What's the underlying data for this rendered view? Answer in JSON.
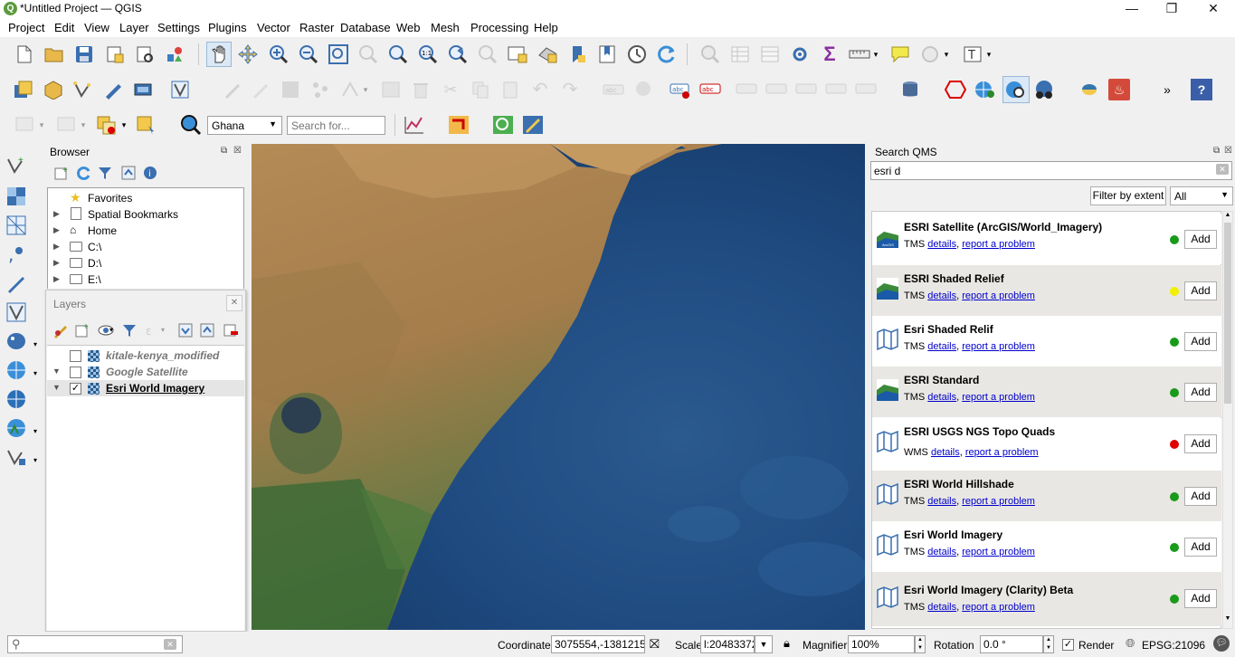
{
  "window": {
    "title": "*Untitled Project — QGIS",
    "minimize": "—",
    "maximize": "❐",
    "close": "✕"
  },
  "menu": [
    "Project",
    "Edit",
    "View",
    "Layer",
    "Settings",
    "Plugins",
    "Vector",
    "Raster",
    "Database",
    "Web",
    "Mesh",
    "Processing",
    "Help"
  ],
  "toolbar3": {
    "locale_value": "Ghana",
    "search_placeholder": "Search for..."
  },
  "browser": {
    "title": "Browser",
    "items": [
      {
        "label": "Favorites",
        "icon": "star-icon"
      },
      {
        "label": "Spatial Bookmarks",
        "icon": "bookmark-icon"
      },
      {
        "label": "Home",
        "icon": "home-icon"
      },
      {
        "label": "C:\\",
        "icon": "folder-icon"
      },
      {
        "label": "D:\\",
        "icon": "folder-icon"
      },
      {
        "label": "E:\\",
        "icon": "folder-icon"
      }
    ]
  },
  "layers": {
    "title": "Layers",
    "items": [
      {
        "label": "kitale-kenya_modified",
        "checked": false,
        "visible": false
      },
      {
        "label": "Google Satellite",
        "checked": false,
        "visible": false
      },
      {
        "label": "Esri World Imagery",
        "checked": true,
        "visible": true
      }
    ]
  },
  "qms": {
    "title": "Search QMS",
    "search_value": "esri d",
    "filter_button": "Filter by extent",
    "filter_select": "All",
    "items": [
      {
        "name": "ESRI Satellite (ArcGIS/World_Imagery)",
        "type": "TMS",
        "details": "details",
        "report": "report a problem",
        "status_color": "#1a9a1a",
        "add": "Add",
        "icon": "arcgis-icon"
      },
      {
        "name": "ESRI Shaded Relief",
        "type": "TMS",
        "details": "details",
        "report": "report a problem",
        "status_color": "#f0f000",
        "add": "Add",
        "icon": "arcgis-icon"
      },
      {
        "name": "Esri Shaded Relif",
        "type": "TMS",
        "details": "details",
        "report": "report a problem",
        "status_color": "#1a9a1a",
        "add": "Add",
        "icon": "map-icon"
      },
      {
        "name": "ESRI Standard",
        "type": "TMS",
        "details": "details",
        "report": "report a problem",
        "status_color": "#1a9a1a",
        "add": "Add",
        "icon": "arcgis-icon"
      },
      {
        "name": "ESRI USGS NGS Topo Quads",
        "type": "WMS",
        "details": "details",
        "report": "report a problem",
        "status_color": "#e00000",
        "add": "Add",
        "icon": "map-icon"
      },
      {
        "name": "ESRI World Hillshade",
        "type": "TMS",
        "details": "details",
        "report": "report a problem",
        "status_color": "#1a9a1a",
        "add": "Add",
        "icon": "map-icon"
      },
      {
        "name": "Esri World Imagery",
        "type": "TMS",
        "details": "details",
        "report": "report a problem",
        "status_color": "#1a9a1a",
        "add": "Add",
        "icon": "map-icon"
      },
      {
        "name": "Esri World Imagery (Clarity) Beta",
        "type": "TMS",
        "details": "details",
        "report": "report a problem",
        "status_color": "#1a9a1a",
        "add": "Add",
        "icon": "map-icon"
      }
    ]
  },
  "statusbar": {
    "coordinate_label": "Coordinate",
    "coordinate_value": "3075554,-1381215",
    "scale_label": "Scale",
    "scale_value": "l:20483372",
    "magnifier_label": "Magnifier",
    "magnifier_value": "100%",
    "rotation_label": "Rotation",
    "rotation_value": "0.0 °",
    "render_label": "Render",
    "render_checked": true,
    "crs_value": "EPSG:21096"
  }
}
